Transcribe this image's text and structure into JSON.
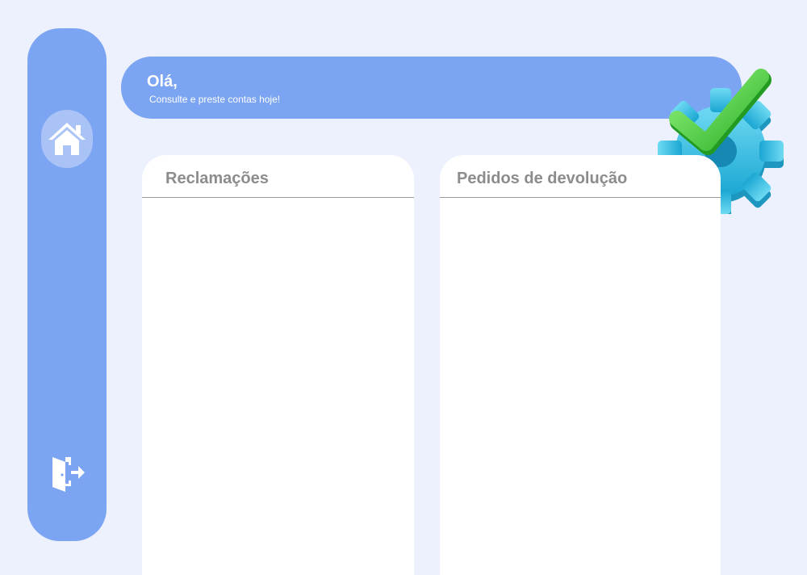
{
  "header": {
    "greeting": "Olá,",
    "subtitle": "Consulte e preste contas hoje!"
  },
  "sidebar": {
    "items": [
      {
        "icon": "home-icon"
      },
      {
        "icon": "exit-icon"
      }
    ]
  },
  "panels": [
    {
      "title": "Reclamações",
      "items": []
    },
    {
      "title": "Pedidos de devolução",
      "items": []
    }
  ],
  "colors": {
    "background": "#edf1fd",
    "accent": "#7ba4f2",
    "panel": "#ffffff",
    "panel_title": "#8c8c8c",
    "gear": "#3fc6e6",
    "check": "#3cbf3a"
  }
}
